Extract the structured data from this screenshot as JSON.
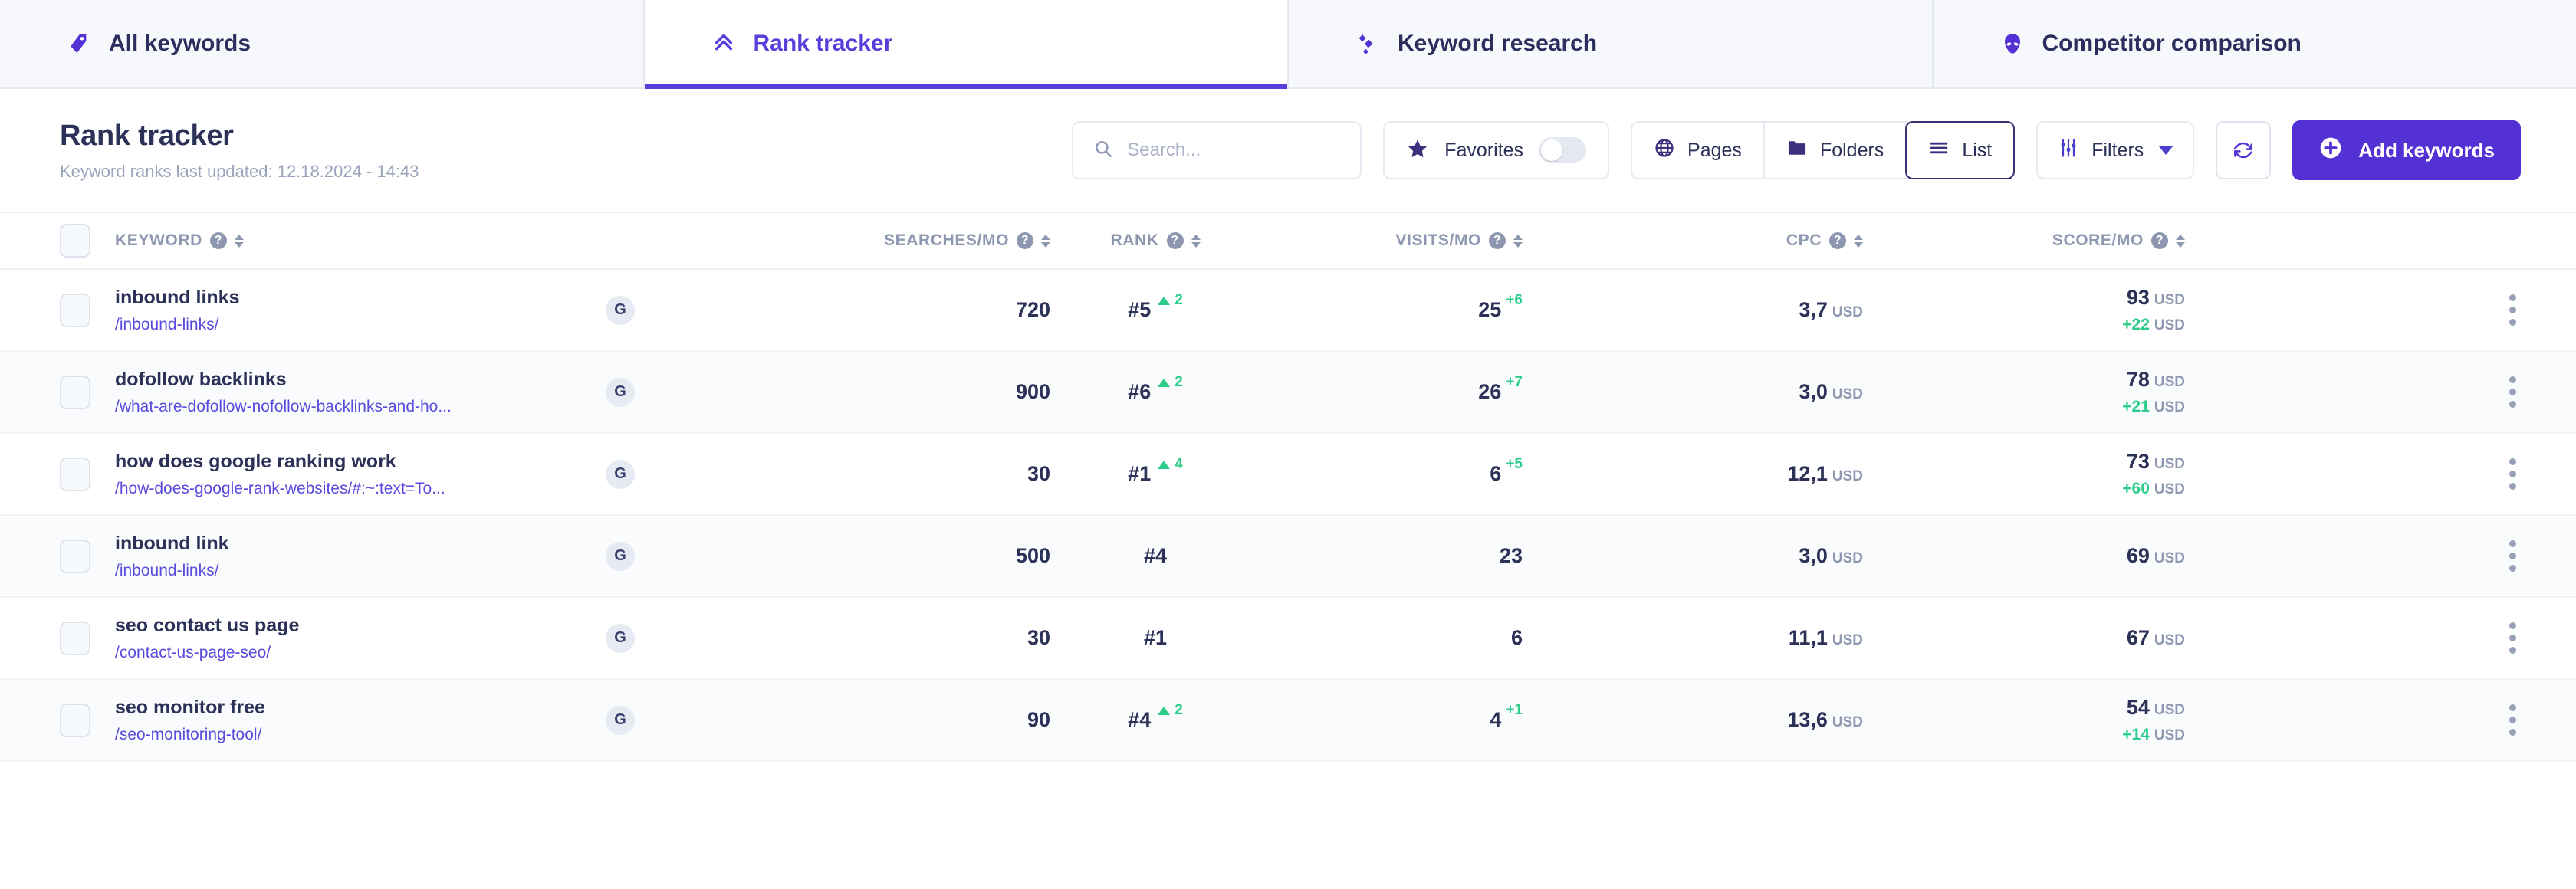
{
  "tabs": [
    {
      "label": "All keywords",
      "icon": "tag-icon",
      "active": false
    },
    {
      "label": "Rank tracker",
      "icon": "chevrons-up-icon",
      "active": true
    },
    {
      "label": "Keyword research",
      "icon": "sparkle-icon",
      "active": false
    },
    {
      "label": "Competitor comparison",
      "icon": "alien-icon",
      "active": false
    }
  ],
  "header": {
    "title": "Rank tracker",
    "subtitle": "Keyword ranks last updated: 12.18.2024 - 14:43"
  },
  "toolbar": {
    "search_placeholder": "Search...",
    "search_value": "",
    "favorites_label": "Favorites",
    "favorites_on": false,
    "pages_label": "Pages",
    "folders_label": "Folders",
    "list_label": "List",
    "selected_view": "List",
    "filters_label": "Filters",
    "refresh_label": "Refresh",
    "add_keywords_label": "Add keywords"
  },
  "colors": {
    "accent": "#5331d4",
    "link": "#5b4bdd",
    "positive": "#2ecc8a",
    "text": "#2c3158",
    "muted": "#8e97b0"
  },
  "table": {
    "columns": [
      {
        "key": "keyword",
        "label": "KEYWORD"
      },
      {
        "key": "searches",
        "label": "SEARCHES/MO"
      },
      {
        "key": "rank",
        "label": "RANK"
      },
      {
        "key": "visits",
        "label": "VISITS/MO"
      },
      {
        "key": "cpc",
        "label": "CPC"
      },
      {
        "key": "score",
        "label": "SCORE/MO"
      }
    ],
    "rows": [
      {
        "keyword": "inbound links",
        "url": "/inbound-links/",
        "engine": "G",
        "searches": "720",
        "rank": "#5",
        "rank_delta": "2",
        "rank_dir": "up",
        "visits": "25",
        "visits_delta": "+6",
        "cpc": "3,7",
        "cpc_unit": "USD",
        "score": "93",
        "score_unit": "USD",
        "score_delta": "+22",
        "score_delta_unit": "USD"
      },
      {
        "keyword": "dofollow backlinks",
        "url": "/what-are-dofollow-nofollow-backlinks-and-ho...",
        "engine": "G",
        "searches": "900",
        "rank": "#6",
        "rank_delta": "2",
        "rank_dir": "up",
        "visits": "26",
        "visits_delta": "+7",
        "cpc": "3,0",
        "cpc_unit": "USD",
        "score": "78",
        "score_unit": "USD",
        "score_delta": "+21",
        "score_delta_unit": "USD"
      },
      {
        "keyword": "how does google ranking work",
        "url": "/how-does-google-rank-websites/#:~:text=To...",
        "engine": "G",
        "searches": "30",
        "rank": "#1",
        "rank_delta": "4",
        "rank_dir": "up",
        "visits": "6",
        "visits_delta": "+5",
        "cpc": "12,1",
        "cpc_unit": "USD",
        "score": "73",
        "score_unit": "USD",
        "score_delta": "+60",
        "score_delta_unit": "USD"
      },
      {
        "keyword": "inbound link",
        "url": "/inbound-links/",
        "engine": "G",
        "searches": "500",
        "rank": "#4",
        "rank_delta": "",
        "rank_dir": "",
        "visits": "23",
        "visits_delta": "",
        "cpc": "3,0",
        "cpc_unit": "USD",
        "score": "69",
        "score_unit": "USD",
        "score_delta": "",
        "score_delta_unit": ""
      },
      {
        "keyword": "seo contact us page",
        "url": "/contact-us-page-seo/",
        "engine": "G",
        "searches": "30",
        "rank": "#1",
        "rank_delta": "",
        "rank_dir": "",
        "visits": "6",
        "visits_delta": "",
        "cpc": "11,1",
        "cpc_unit": "USD",
        "score": "67",
        "score_unit": "USD",
        "score_delta": "",
        "score_delta_unit": ""
      },
      {
        "keyword": "seo monitor free",
        "url": "/seo-monitoring-tool/",
        "engine": "G",
        "searches": "90",
        "rank": "#4",
        "rank_delta": "2",
        "rank_dir": "up",
        "visits": "4",
        "visits_delta": "+1",
        "cpc": "13,6",
        "cpc_unit": "USD",
        "score": "54",
        "score_unit": "USD",
        "score_delta": "+14",
        "score_delta_unit": "USD"
      }
    ]
  }
}
